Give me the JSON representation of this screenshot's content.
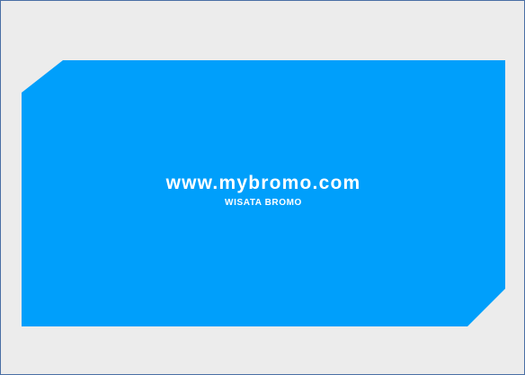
{
  "card": {
    "url": "www.mybromo.com",
    "tagline": "WISATA BROMO"
  },
  "colors": {
    "background": "#ececec",
    "border": "#4a6fa5",
    "card": "#009ffb",
    "text": "#ffffff"
  }
}
